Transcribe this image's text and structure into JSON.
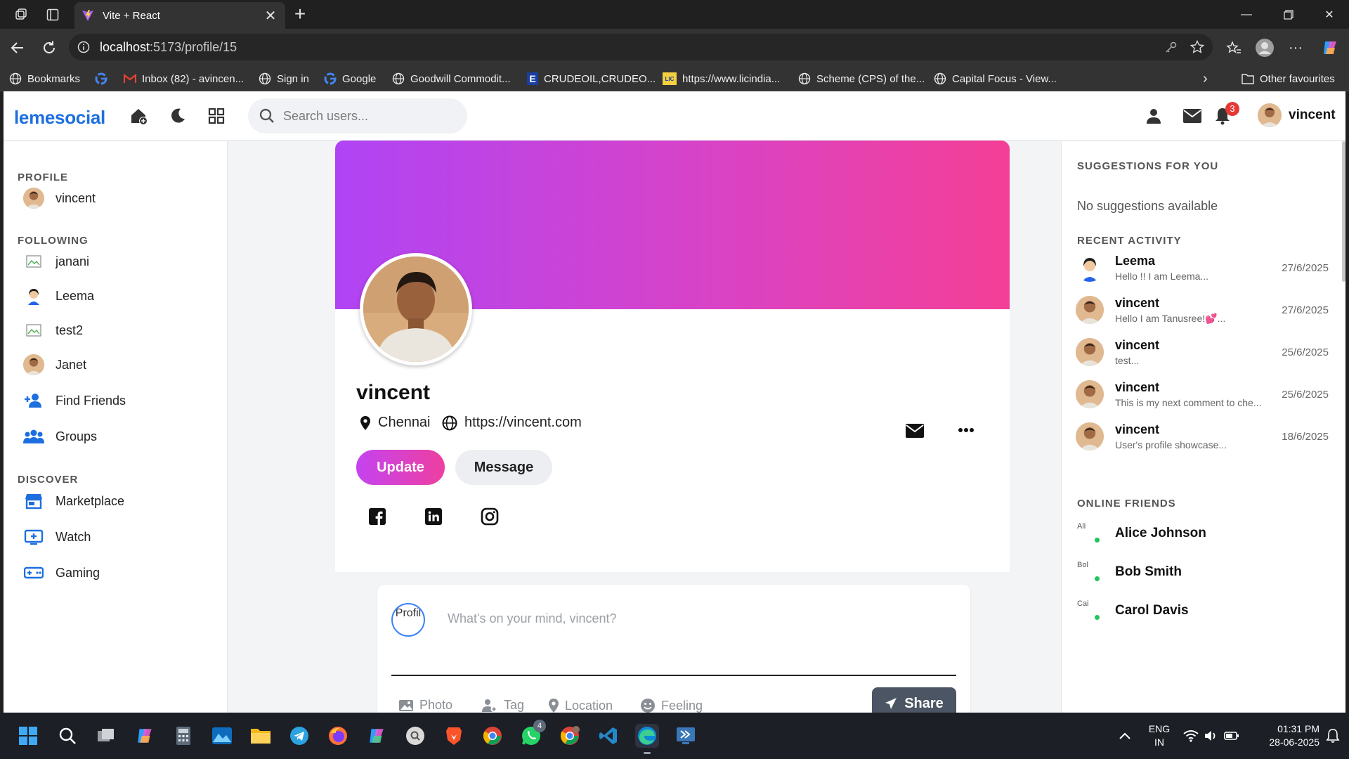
{
  "browser": {
    "tab_title": "Vite + React",
    "url_host": "localhost",
    "url_path": ":5173/profile/15",
    "bookmarks": [
      {
        "label": "Bookmarks",
        "icon": "globe-icon"
      },
      {
        "label": "",
        "icon": "google-icon"
      },
      {
        "label": "Inbox (82) - avincen...",
        "icon": "gmail-icon"
      },
      {
        "label": "Sign in",
        "icon": "globe-icon"
      },
      {
        "label": "Google",
        "icon": "google-icon"
      },
      {
        "label": "Goodwill Commodit...",
        "icon": "globe-icon"
      },
      {
        "label": "CRUDEOIL,CRUDEO...",
        "icon": "e-icon"
      },
      {
        "label": "https://www.licindia...",
        "icon": "lic-icon"
      },
      {
        "label": "Scheme (CPS) of the...",
        "icon": "globe-icon"
      },
      {
        "label": "Capital Focus - View...",
        "icon": "globe-icon"
      }
    ],
    "other_favourites": "Other favourites"
  },
  "app": {
    "logo": "lemesocial",
    "search_placeholder": "Search users...",
    "notification_count": "3",
    "current_user": "vincent"
  },
  "leftbar": {
    "profile_title": "PROFILE",
    "profile_user": "vincent",
    "following_title": "FOLLOWING",
    "following": [
      "janani",
      "Leema",
      "test2",
      "Janet"
    ],
    "find_friends": "Find Friends",
    "groups": "Groups",
    "discover_title": "DISCOVER",
    "discover": [
      "Marketplace",
      "Watch",
      "Gaming"
    ]
  },
  "profile": {
    "name": "vincent",
    "city": "Chennai",
    "website": "https://vincent.com",
    "update_label": "Update",
    "message_label": "Message",
    "colors": {
      "cover_start": "#b044f5",
      "cover_end": "#f43f96"
    }
  },
  "composer": {
    "avatar_alt": "Profil",
    "placeholder": "What's on your mind, vincent?",
    "actions": [
      "Photo",
      "Tag",
      "Location",
      "Feeling"
    ],
    "share_label": "Share"
  },
  "rightbar": {
    "suggestions_title": "SUGGESTIONS FOR YOU",
    "suggestions_empty": "No suggestions available",
    "activity_title": "RECENT ACTIVITY",
    "activity": [
      {
        "name": "Leema",
        "text": "Hello !! I am Leema...",
        "date": "27/6/2025"
      },
      {
        "name": "vincent",
        "text": "Hello I am Tanusree!💕...",
        "date": "27/6/2025"
      },
      {
        "name": "vincent",
        "text": "test...",
        "date": "25/6/2025"
      },
      {
        "name": "vincent",
        "text": "This is my next comment to che...",
        "date": "25/6/2025"
      },
      {
        "name": "vincent",
        "text": "User's profile showcase...",
        "date": "18/6/2025"
      }
    ],
    "online_title": "ONLINE FRIENDS",
    "online": [
      {
        "name": "Alice Johnson",
        "alt": "Ali"
      },
      {
        "name": "Bob Smith",
        "alt": "Bol"
      },
      {
        "name": "Carol Davis",
        "alt": "Cai"
      }
    ]
  },
  "taskbar": {
    "lang_1": "ENG",
    "lang_2": "IN",
    "time": "01:31 PM",
    "date": "28-06-2025",
    "whatsapp_badge": "4"
  }
}
